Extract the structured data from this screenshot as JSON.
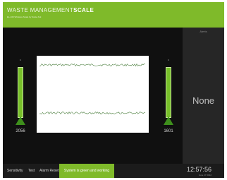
{
  "header": {
    "title_main": "WASTE MANAGEMENT",
    "title_bold": "SCALE",
    "subtitle": "EL-100 Wireless Scale by Scale-Tek"
  },
  "gauges": {
    "left": {
      "caption": "lb",
      "value": "2056",
      "level": 1.0
    },
    "right": {
      "caption": "lb",
      "value": "1601",
      "level": 1.0
    }
  },
  "right_panel": {
    "label": "Alerts",
    "value": "None"
  },
  "bottom": {
    "buttons": [
      "Sensitivity",
      "Test",
      "Alarm Reset"
    ],
    "status": "System is green and working",
    "time": "12:57:56",
    "date": "June 27 2012"
  },
  "colors": {
    "accent": "#7fba2a",
    "background": "#101010",
    "trace": "#4c7f3f"
  }
}
